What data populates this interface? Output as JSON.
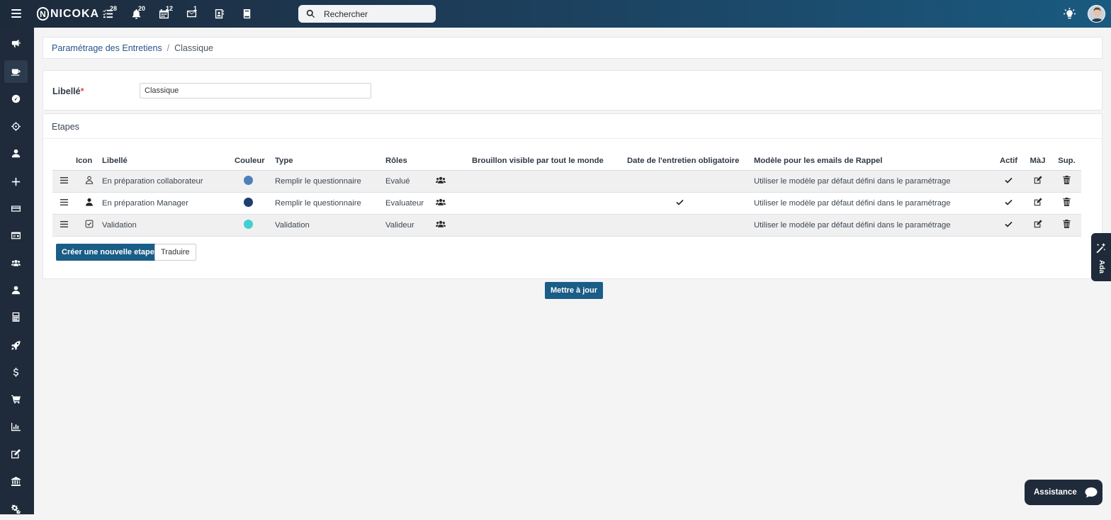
{
  "topbar": {
    "logo_text": "NICOKA",
    "logo_mark": "N",
    "icons": [
      {
        "name": "tasks-icon",
        "badge": "28"
      },
      {
        "name": "bell-icon",
        "badge": "20"
      },
      {
        "name": "calendar-icon",
        "badge": "12"
      },
      {
        "name": "mail-icon",
        "badge": "1"
      },
      {
        "name": "contacts-icon",
        "badge": ""
      },
      {
        "name": "book-icon",
        "badge": ""
      }
    ],
    "search_placeholder": "Rechercher"
  },
  "sidebar": {
    "items": [
      {
        "name": "megaphone-icon"
      },
      {
        "name": "coffee-icon",
        "active": true
      },
      {
        "name": "dashboard-icon"
      },
      {
        "name": "crosshair-icon"
      },
      {
        "name": "user-icon"
      },
      {
        "name": "plus-icon"
      },
      {
        "name": "card-icon"
      },
      {
        "name": "id-card-icon"
      },
      {
        "name": "users-icon"
      },
      {
        "name": "user-tie-icon"
      },
      {
        "name": "calculator-icon"
      },
      {
        "name": "rocket-icon"
      },
      {
        "name": "dollar-icon"
      },
      {
        "name": "cart-icon"
      },
      {
        "name": "chart-icon"
      },
      {
        "name": "edit-icon"
      },
      {
        "name": "bank-icon"
      },
      {
        "name": "cogs-icon"
      }
    ]
  },
  "breadcrumb": {
    "parent": "Paramétrage des Entretiens",
    "separator": "/",
    "current": "Classique"
  },
  "form": {
    "label": "Libellé",
    "required_mark": "*",
    "value": "Classique"
  },
  "steps": {
    "title": "Etapes",
    "columns": {
      "icon": "Icon",
      "libelle": "Libellé",
      "couleur": "Couleur",
      "type": "Type",
      "roles": "Rôles",
      "brouillon": "Brouillon visible par tout le monde",
      "date": "Date de l'entretien obligatoire",
      "modele": "Modèle pour les emails de Rappel",
      "actif": "Actif",
      "maj": "MàJ",
      "sup": "Sup."
    },
    "rows": [
      {
        "icon": "user-outline-icon",
        "libelle": "En préparation collaborateur",
        "color": "#4f7fb8",
        "type": "Remplir le questionnaire",
        "role": "Evalué",
        "brouillon": false,
        "date": false,
        "modele": "Utiliser le modèle par défaut défini dans le paramétrage",
        "actif": true
      },
      {
        "icon": "user-solid-icon",
        "libelle": "En préparation Manager",
        "color": "#1f3e6e",
        "type": "Remplir le questionnaire",
        "role": "Evaluateur",
        "brouillon": false,
        "date": true,
        "modele": "Utiliser le modèle par défaut défini dans le paramétrage",
        "actif": true
      },
      {
        "icon": "checkbox-icon",
        "libelle": "Validation",
        "color": "#43cfcf",
        "type": "Validation",
        "role": "Valideur",
        "brouillon": false,
        "date": false,
        "modele": "Utiliser le modèle par défaut défini dans le paramétrage",
        "actif": true
      }
    ],
    "create_button": "Créer une nouvelle etape",
    "translate_button": "Traduire"
  },
  "update_button": "Mettre à jour",
  "ada_label": "Ada",
  "assistance_label": "Assistance"
}
